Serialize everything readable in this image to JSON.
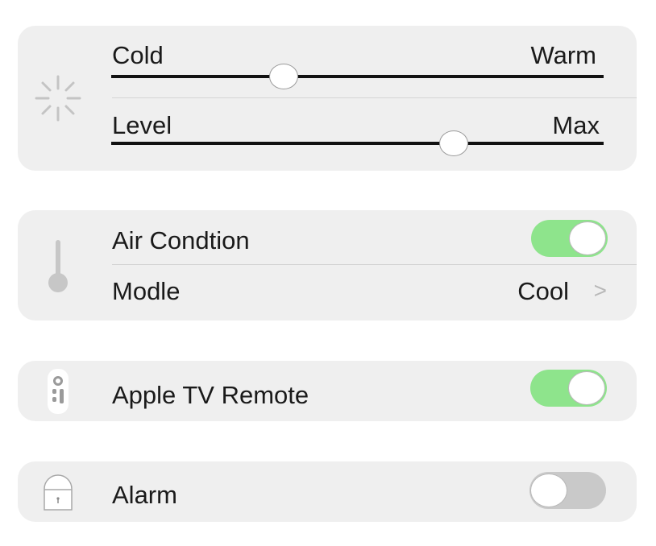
{
  "light": {
    "icon": "light-rays-icon",
    "temperature": {
      "left_label": "Cold",
      "right_label": "Warm",
      "value": 0.35
    },
    "brightness": {
      "left_label": "Level",
      "right_label": "Max",
      "value": 0.695
    }
  },
  "climate": {
    "icon": "thermometer-icon",
    "air_condition": {
      "label": "Air Condtion",
      "on": true
    },
    "mode": {
      "label": "Modle",
      "value": "Cool",
      "chevron": ">"
    }
  },
  "remote": {
    "icon": "apple-tv-remote-icon",
    "label": "Apple TV Remote",
    "on": true
  },
  "alarm": {
    "icon": "lock-icon",
    "label": "Alarm",
    "on": false
  },
  "colors": {
    "card": "#efefef",
    "toggle_on": "#8ee48c",
    "toggle_off": "#c9c9c9",
    "track": "#111111"
  }
}
